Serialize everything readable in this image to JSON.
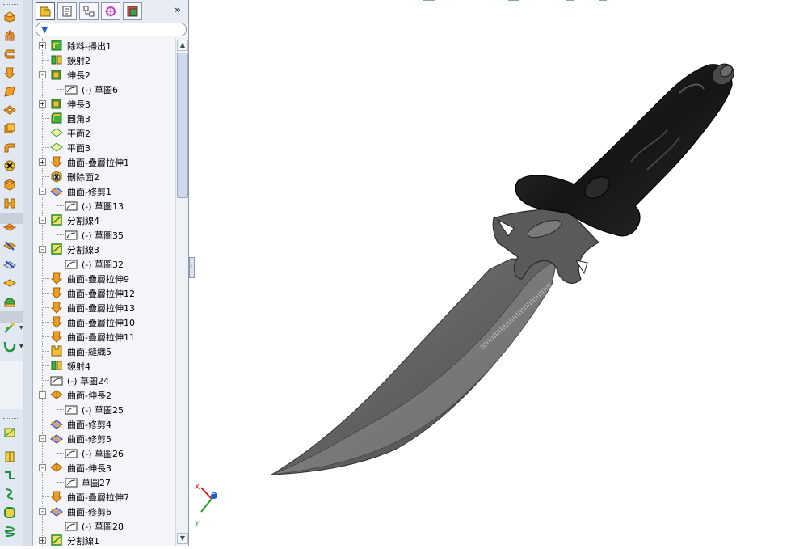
{
  "feature_tree": {
    "items": [
      {
        "label": "除料-掃出1",
        "expand": "+",
        "icon": "cut-sweep-icon"
      },
      {
        "label": "鏡射2",
        "expand": "",
        "icon": "mirror-icon"
      },
      {
        "label": "伸長2",
        "expand": "−",
        "icon": "extrude-icon"
      },
      {
        "label": "(-) 草圖6",
        "expand": "",
        "icon": "sketch-icon",
        "child": true
      },
      {
        "label": "伸長3",
        "expand": "+",
        "icon": "extrude-icon"
      },
      {
        "label": "圓角3",
        "expand": "",
        "icon": "fillet-icon"
      },
      {
        "label": "平面2",
        "expand": "",
        "icon": "plane-icon"
      },
      {
        "label": "平面3",
        "expand": "",
        "icon": "plane-icon"
      },
      {
        "label": "曲面-疊層拉伸1",
        "expand": "+",
        "icon": "surface-loft-icon"
      },
      {
        "label": "刪除面2",
        "expand": "",
        "icon": "delete-face-icon"
      },
      {
        "label": "曲面-修剪1",
        "expand": "−",
        "icon": "surface-trim-icon"
      },
      {
        "label": "(-) 草圖13",
        "expand": "",
        "icon": "sketch-icon",
        "child": true
      },
      {
        "label": "分割線4",
        "expand": "−",
        "icon": "split-line-icon"
      },
      {
        "label": "(-) 草圖35",
        "expand": "",
        "icon": "sketch-icon",
        "child": true
      },
      {
        "label": "分割線3",
        "expand": "−",
        "icon": "split-line-icon"
      },
      {
        "label": "(-) 草圖32",
        "expand": "",
        "icon": "sketch-icon",
        "child": true
      },
      {
        "label": "曲面-疊層拉伸9",
        "expand": "",
        "icon": "surface-loft-icon"
      },
      {
        "label": "曲面-疊層拉伸12",
        "expand": "",
        "icon": "surface-loft-icon"
      },
      {
        "label": "曲面-疊層拉伸13",
        "expand": "",
        "icon": "surface-loft-icon"
      },
      {
        "label": "曲面-疊層拉伸10",
        "expand": "",
        "icon": "surface-loft-icon"
      },
      {
        "label": "曲面-疊層拉伸11",
        "expand": "",
        "icon": "surface-loft-icon"
      },
      {
        "label": "曲面-縫織5",
        "expand": "",
        "icon": "surface-knit-icon"
      },
      {
        "label": "鏡射4",
        "expand": "",
        "icon": "mirror-icon"
      },
      {
        "label": "(-) 草圖24",
        "expand": "",
        "icon": "sketch-icon"
      },
      {
        "label": "曲面-伸長2",
        "expand": "−",
        "icon": "surface-extend-icon"
      },
      {
        "label": "(-) 草圖25",
        "expand": "",
        "icon": "sketch-icon",
        "child": true
      },
      {
        "label": "曲面-修剪4",
        "expand": "",
        "icon": "surface-trim-icon"
      },
      {
        "label": "曲面-修剪5",
        "expand": "−",
        "icon": "surface-trim-icon"
      },
      {
        "label": "(-) 草圖26",
        "expand": "",
        "icon": "sketch-icon",
        "child": true
      },
      {
        "label": "曲面-伸長3",
        "expand": "−",
        "icon": "surface-extend-icon"
      },
      {
        "label": "草圖27",
        "expand": "",
        "icon": "sketch-icon",
        "child": true
      },
      {
        "label": "曲面-疊層拉伸7",
        "expand": "",
        "icon": "surface-loft-icon"
      },
      {
        "label": "曲面-修剪6",
        "expand": "−",
        "icon": "surface-trim-icon"
      },
      {
        "label": "(-) 草圖28",
        "expand": "",
        "icon": "sketch-icon",
        "child": true
      },
      {
        "label": "分割線1",
        "expand": "+",
        "icon": "split-line-icon"
      }
    ]
  },
  "tabs": [
    "feature-manager-tab",
    "property-manager-tab",
    "configuration-manager-tab",
    "dimxpert-tab",
    "display-manager-tab"
  ],
  "triad": {
    "x": "X",
    "y": "Y",
    "z": "Z"
  },
  "colors": {
    "toolbar_bg": "#e2e8f1",
    "tree_bg": "#f3f5f9",
    "blade": "#5e5e5e",
    "handle": "#1a1a1a"
  }
}
